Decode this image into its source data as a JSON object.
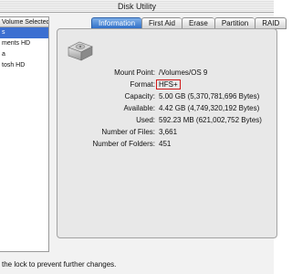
{
  "window": {
    "title": "Disk Utility"
  },
  "sidebar": {
    "header": "Volume Selected",
    "volumes": [
      {
        "label": "s",
        "selected": true
      },
      {
        "label": "ments HD",
        "selected": false
      },
      {
        "label": "a",
        "selected": false
      },
      {
        "label": "tosh HD",
        "selected": false
      }
    ]
  },
  "tabs": [
    {
      "label": "Information",
      "active": true
    },
    {
      "label": "First Aid",
      "active": false
    },
    {
      "label": "Erase",
      "active": false
    },
    {
      "label": "Partition",
      "active": false
    },
    {
      "label": "RAID",
      "active": false
    }
  ],
  "info": {
    "mount_point": {
      "label": "Mount Point:",
      "value": "/Volumes/OS 9"
    },
    "format": {
      "label": "Format:",
      "value": "HFS+"
    },
    "capacity": {
      "label": "Capacity:",
      "value": "5.00 GB (5,370,781,696 Bytes)"
    },
    "available": {
      "label": "Available:",
      "value": "4.42 GB (4,749,320,192 Bytes)"
    },
    "used": {
      "label": "Used:",
      "value": "592.23 MB (621,002,752 Bytes)"
    },
    "files": {
      "label": "Number of Files:",
      "value": "3,661"
    },
    "folders": {
      "label": "Number of Folders:",
      "value": "451"
    }
  },
  "footer": {
    "lock_text": "the lock to prevent further changes."
  },
  "colors": {
    "accent": "#2f6fc8",
    "selection": "#3b6fd1",
    "format_highlight": "#d01818"
  },
  "icons": {
    "drive": "hard-drive-icon"
  }
}
